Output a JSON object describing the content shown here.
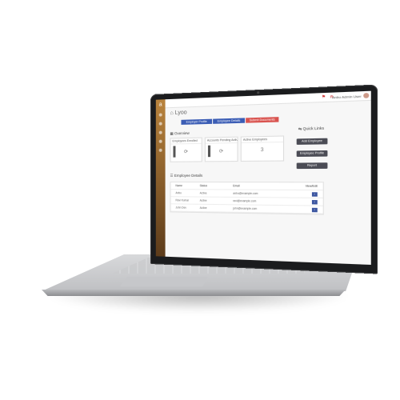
{
  "app": {
    "brand": "Lyoo",
    "logo_letter": "a"
  },
  "topbar": {
    "user_label": "Anbu Admin User",
    "icons": [
      "flag-icon",
      "bell-icon"
    ]
  },
  "steps": [
    {
      "label": "Employer Profile",
      "color": "#3b5db5"
    },
    {
      "label": "Employee Details",
      "color": "#3b5db5"
    },
    {
      "label": "Submit Documents",
      "color": "#d9534f"
    }
  ],
  "overview": {
    "title": "Overview",
    "cards": [
      {
        "header": "Employees Enrolled",
        "value": ""
      },
      {
        "header": "Accounts Pending Activation",
        "value": ""
      },
      {
        "header": "Active Employees",
        "value": "3"
      }
    ]
  },
  "quick_links": {
    "title": "Quick Links",
    "buttons": [
      "Add Employee",
      "Employee Profile",
      "Report"
    ]
  },
  "employees": {
    "title": "Employee Details",
    "columns": [
      "Name",
      "Status",
      "Email",
      "View/Edit"
    ],
    "rows": [
      {
        "name": "Anbu",
        "status": "Active",
        "email": "anbu@example.com"
      },
      {
        "name": "Ravi Kumar",
        "status": "Active",
        "email": "ravi@example.com"
      },
      {
        "name": "John Dev",
        "status": "Active",
        "email": "john@example.com"
      }
    ]
  },
  "colors": {
    "accent": "#3b5db5",
    "danger": "#d9534f",
    "sidebar": "#b9833d",
    "dark_button": "#4b4c55"
  }
}
